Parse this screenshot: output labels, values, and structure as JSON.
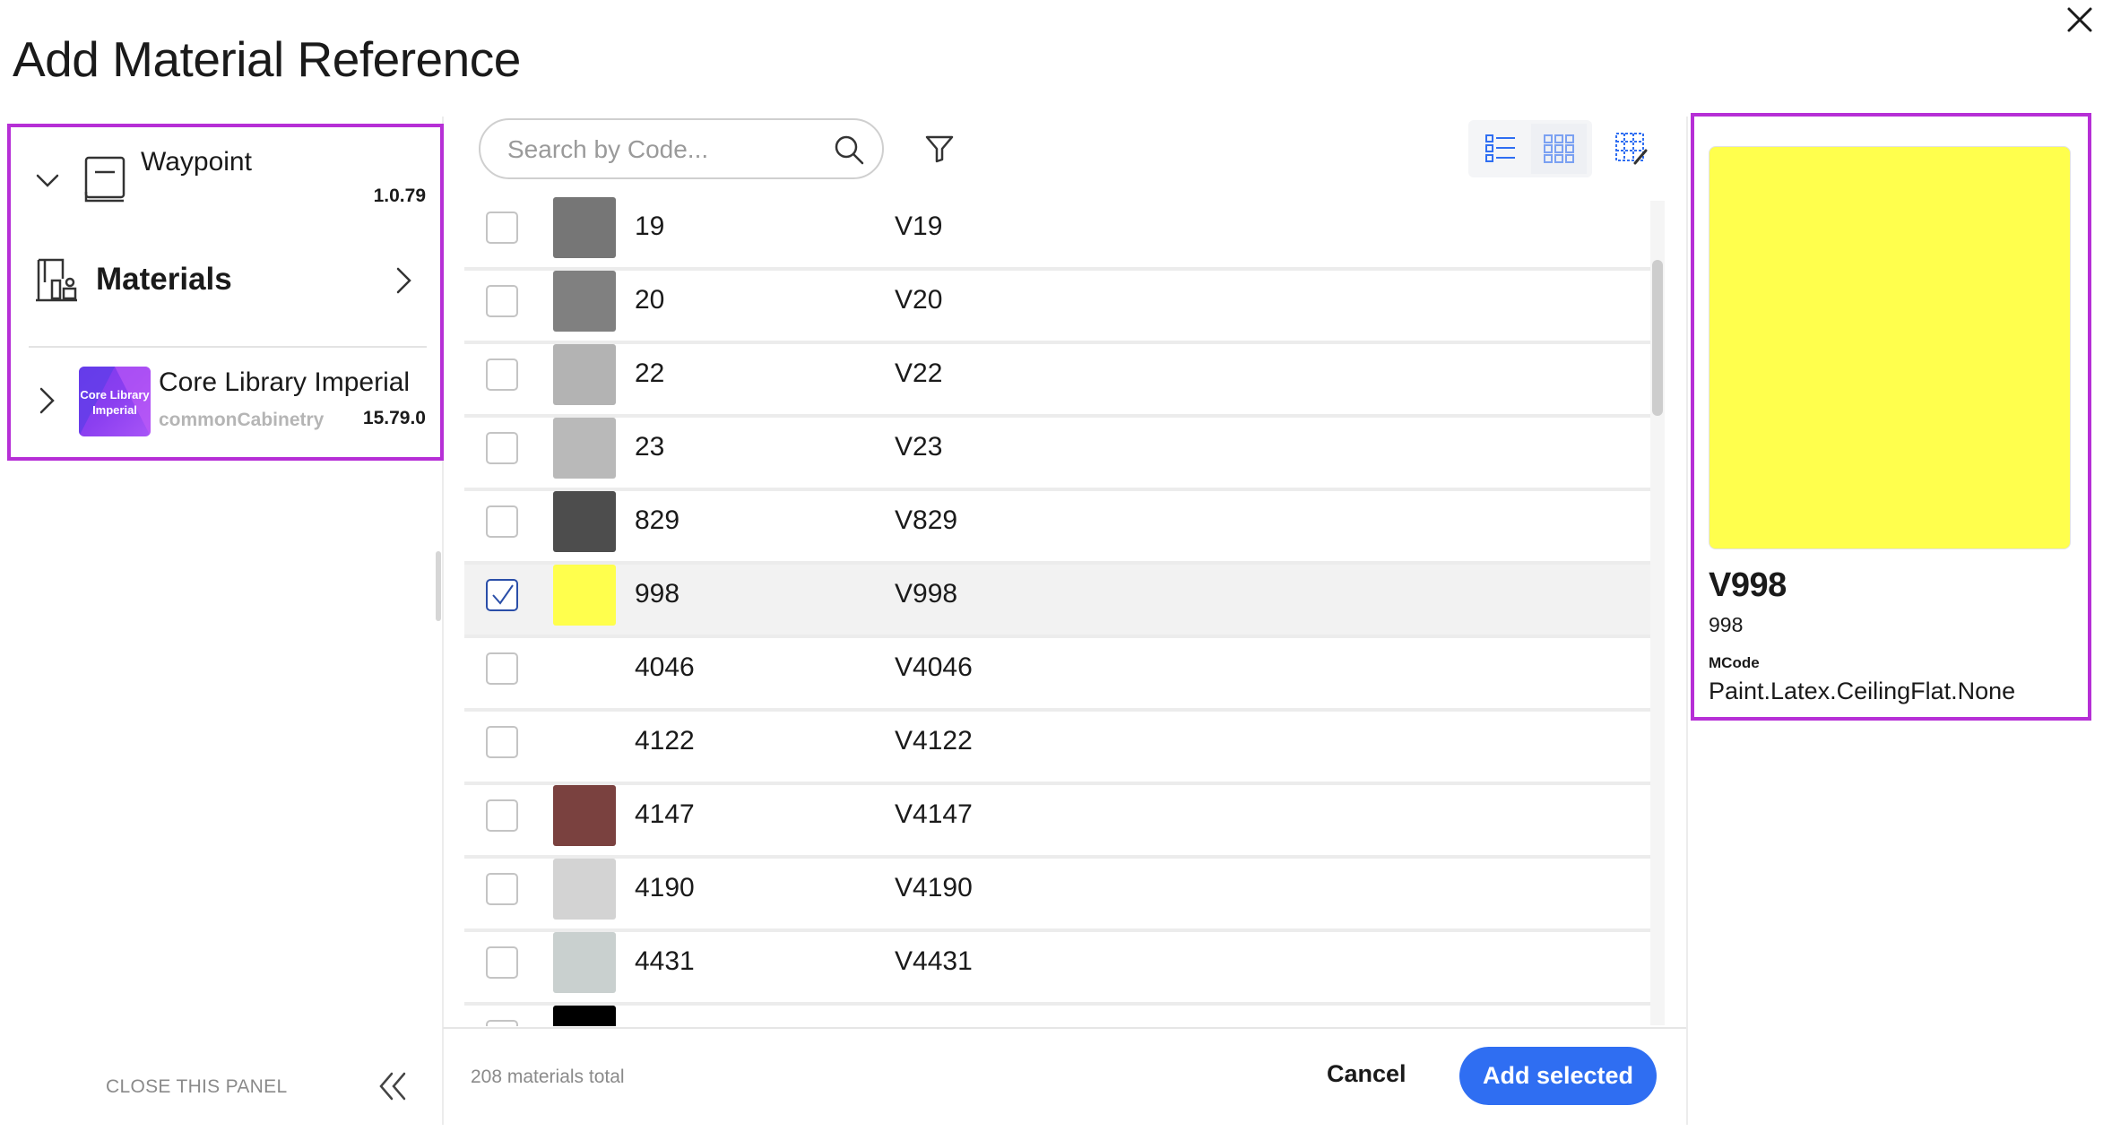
{
  "dialog": {
    "title": "Add Material Reference"
  },
  "sidebar": {
    "waypoint": {
      "name": "Waypoint",
      "version": "1.0.79"
    },
    "materials": {
      "label": "Materials"
    },
    "core_library": {
      "logo_text": "Core Library Imperial",
      "name": "Core Library Imperial",
      "subtitle": "commonCabinetry",
      "version": "15.79.0"
    },
    "close_panel_label": "CLOSE THIS PANEL"
  },
  "search": {
    "placeholder": "Search by Code..."
  },
  "materials": [
    {
      "code": "19",
      "vcode": "V19",
      "color": "#767676",
      "checked": false
    },
    {
      "code": "20",
      "vcode": "V20",
      "color": "#808080",
      "checked": false
    },
    {
      "code": "22",
      "vcode": "V22",
      "color": "#b3b3b3",
      "checked": false
    },
    {
      "code": "23",
      "vcode": "V23",
      "color": "#b9b9b9",
      "checked": false
    },
    {
      "code": "829",
      "vcode": "V829",
      "color": "#4d4d4d",
      "checked": false
    },
    {
      "code": "998",
      "vcode": "V998",
      "color": "#ffff4d",
      "checked": true
    },
    {
      "code": "4046",
      "vcode": "V4046",
      "color": "",
      "checked": false
    },
    {
      "code": "4122",
      "vcode": "V4122",
      "color": "",
      "checked": false
    },
    {
      "code": "4147",
      "vcode": "V4147",
      "color": "#7a413f",
      "checked": false
    },
    {
      "code": "4190",
      "vcode": "V4190",
      "color": "#d3d3d3",
      "checked": false
    },
    {
      "code": "4431",
      "vcode": "V4431",
      "color": "#c9d0cf",
      "checked": false
    },
    {
      "code": "",
      "vcode": "",
      "color": "#000000",
      "checked": false
    }
  ],
  "footer": {
    "total": "208 materials total",
    "cancel_label": "Cancel",
    "add_label": "Add selected"
  },
  "detail": {
    "name": "V998",
    "code": "998",
    "mcode_label": "MCode",
    "mcode": "Paint.Latex.CeilingFlat.None",
    "color": "#ffff4d"
  },
  "colors": {
    "accent": "#2f6ef2",
    "highlight": "#b62fd6",
    "checkbox_checked": "#2a4ea8"
  }
}
